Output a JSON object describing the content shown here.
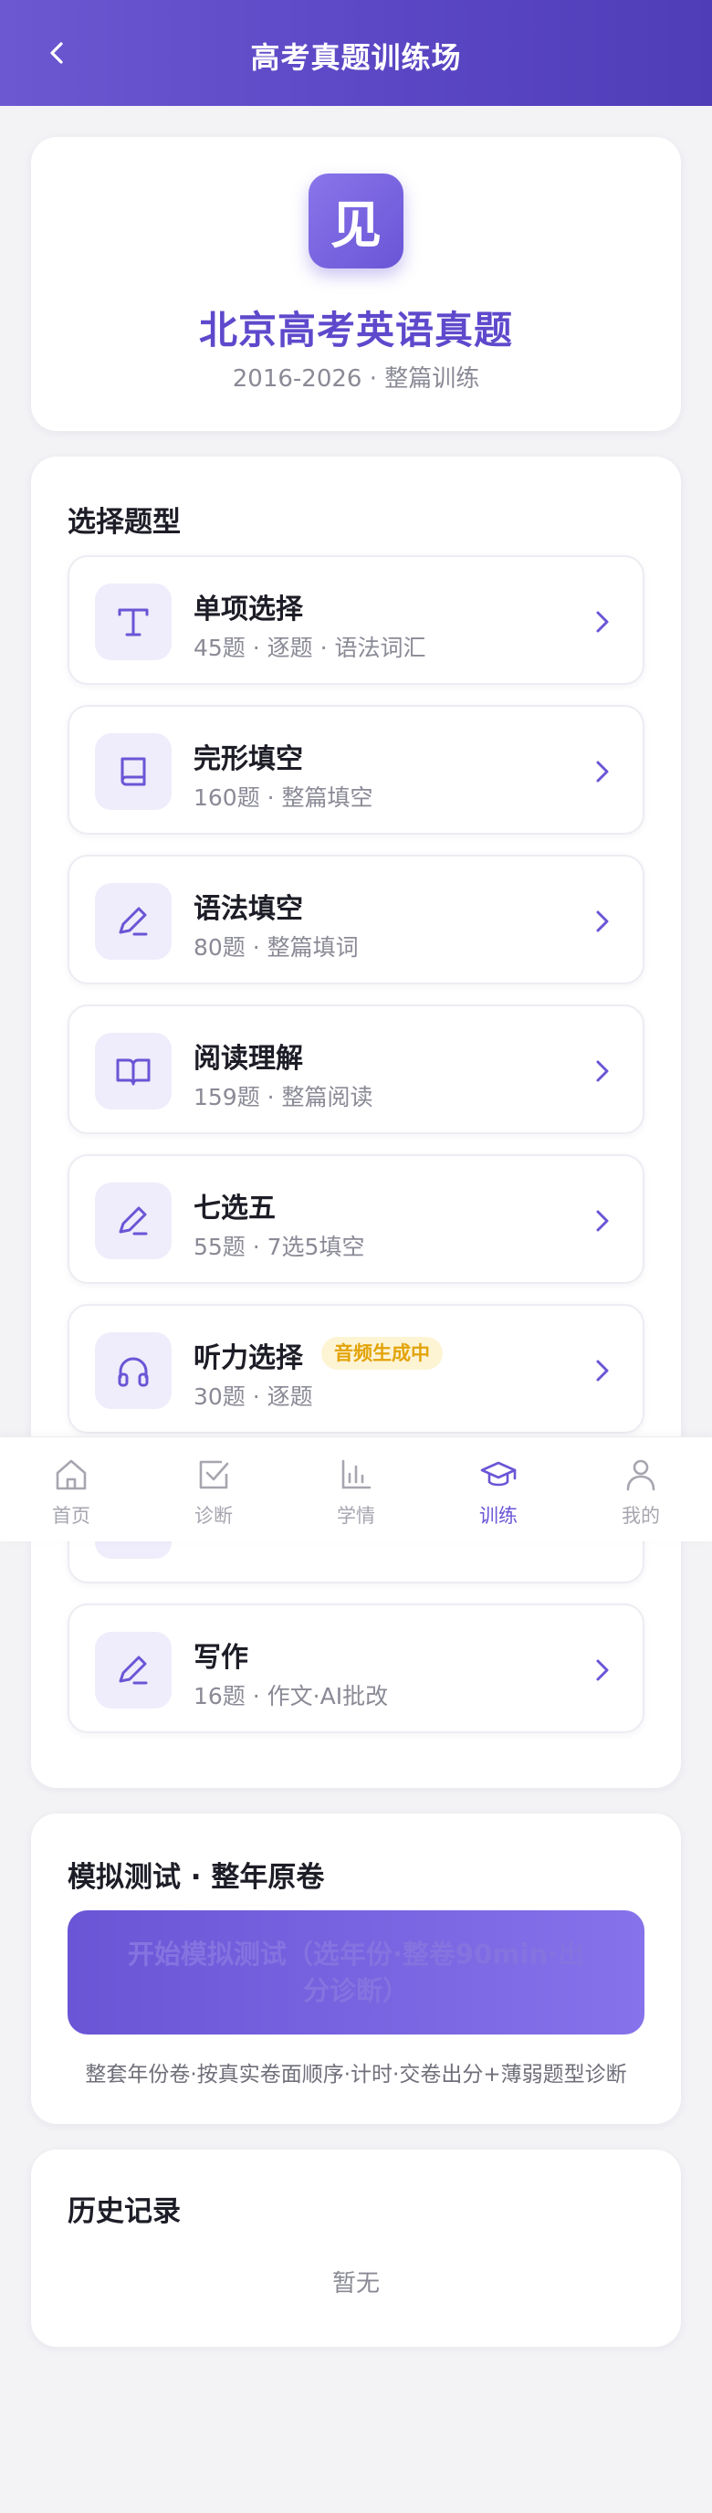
{
  "header": {
    "title": "高考真题训练场",
    "back_icon": "chevron-left-icon"
  },
  "hero": {
    "logo_char": "见",
    "title": "北京高考英语真题",
    "subtitle": "2016-2026 · 整篇训练",
    "accent": "#5e49cc"
  },
  "types": {
    "section_title": "选择题型",
    "items": [
      {
        "name": "单项选择",
        "meta": "45题 · 逐题 · 语法词汇",
        "icon": "text-icon"
      },
      {
        "name": "完形填空",
        "meta": "160题 · 整篇填空",
        "icon": "book-icon"
      },
      {
        "name": "语法填空",
        "meta": "80题 · 整篇填词",
        "icon": "pen-icon"
      },
      {
        "name": "阅读理解",
        "meta": "159题 · 整篇阅读",
        "icon": "open-book-icon"
      },
      {
        "name": "七选五",
        "meta": "55题 · 7选5填空",
        "icon": "pen-icon"
      },
      {
        "name": "听力选择",
        "meta": "30题 · 逐题",
        "icon": "headphones-icon",
        "badge": "音频生成中"
      },
      {
        "name": "",
        "meta": "",
        "icon": "",
        "partial": true
      },
      {
        "name": "写作",
        "meta": "16题 · 作文·AI批改",
        "icon": "pen-icon"
      }
    ]
  },
  "nav": {
    "items": [
      {
        "label": "首页",
        "icon": "home-icon"
      },
      {
        "label": "诊断",
        "icon": "checkbox-icon"
      },
      {
        "label": "学情",
        "icon": "bar-chart-icon"
      },
      {
        "label": "训练",
        "icon": "graduation-cap-icon",
        "active": true
      },
      {
        "label": "我的",
        "icon": "user-icon"
      }
    ],
    "active_color": "#6a55d6"
  },
  "mock": {
    "section_title": "模拟测试 · 整年原卷",
    "button_label": "开始模拟测试（选年份·整卷90min·出分诊断）",
    "description": "整套年份卷·按真实卷面顺序·计时·交卷出分+薄弱题型诊断"
  },
  "history": {
    "section_title": "历史记录",
    "empty_text": "暂无"
  }
}
